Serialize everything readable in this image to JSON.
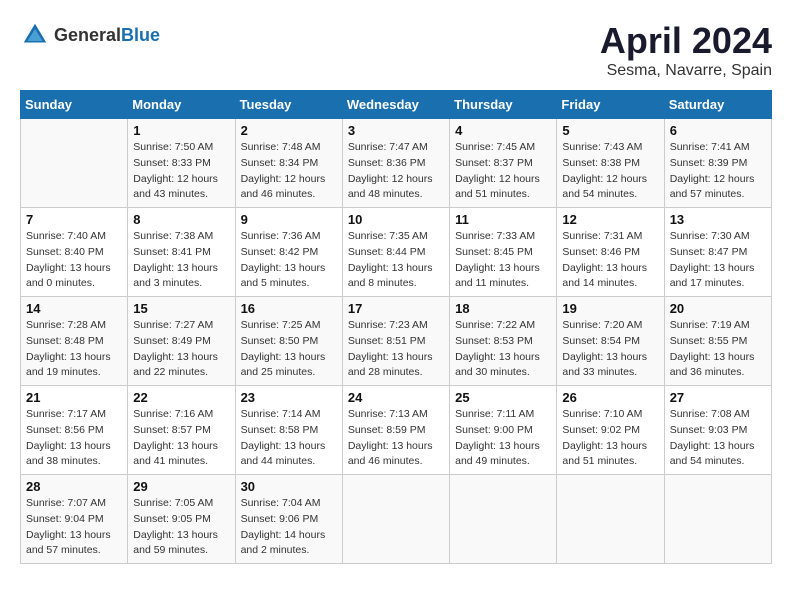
{
  "header": {
    "logo_general": "General",
    "logo_blue": "Blue",
    "month": "April 2024",
    "location": "Sesma, Navarre, Spain"
  },
  "days_of_week": [
    "Sunday",
    "Monday",
    "Tuesday",
    "Wednesday",
    "Thursday",
    "Friday",
    "Saturday"
  ],
  "weeks": [
    [
      {
        "day": "",
        "info": ""
      },
      {
        "day": "1",
        "info": "Sunrise: 7:50 AM\nSunset: 8:33 PM\nDaylight: 12 hours\nand 43 minutes."
      },
      {
        "day": "2",
        "info": "Sunrise: 7:48 AM\nSunset: 8:34 PM\nDaylight: 12 hours\nand 46 minutes."
      },
      {
        "day": "3",
        "info": "Sunrise: 7:47 AM\nSunset: 8:36 PM\nDaylight: 12 hours\nand 48 minutes."
      },
      {
        "day": "4",
        "info": "Sunrise: 7:45 AM\nSunset: 8:37 PM\nDaylight: 12 hours\nand 51 minutes."
      },
      {
        "day": "5",
        "info": "Sunrise: 7:43 AM\nSunset: 8:38 PM\nDaylight: 12 hours\nand 54 minutes."
      },
      {
        "day": "6",
        "info": "Sunrise: 7:41 AM\nSunset: 8:39 PM\nDaylight: 12 hours\nand 57 minutes."
      }
    ],
    [
      {
        "day": "7",
        "info": "Sunrise: 7:40 AM\nSunset: 8:40 PM\nDaylight: 13 hours\nand 0 minutes."
      },
      {
        "day": "8",
        "info": "Sunrise: 7:38 AM\nSunset: 8:41 PM\nDaylight: 13 hours\nand 3 minutes."
      },
      {
        "day": "9",
        "info": "Sunrise: 7:36 AM\nSunset: 8:42 PM\nDaylight: 13 hours\nand 5 minutes."
      },
      {
        "day": "10",
        "info": "Sunrise: 7:35 AM\nSunset: 8:44 PM\nDaylight: 13 hours\nand 8 minutes."
      },
      {
        "day": "11",
        "info": "Sunrise: 7:33 AM\nSunset: 8:45 PM\nDaylight: 13 hours\nand 11 minutes."
      },
      {
        "day": "12",
        "info": "Sunrise: 7:31 AM\nSunset: 8:46 PM\nDaylight: 13 hours\nand 14 minutes."
      },
      {
        "day": "13",
        "info": "Sunrise: 7:30 AM\nSunset: 8:47 PM\nDaylight: 13 hours\nand 17 minutes."
      }
    ],
    [
      {
        "day": "14",
        "info": "Sunrise: 7:28 AM\nSunset: 8:48 PM\nDaylight: 13 hours\nand 19 minutes."
      },
      {
        "day": "15",
        "info": "Sunrise: 7:27 AM\nSunset: 8:49 PM\nDaylight: 13 hours\nand 22 minutes."
      },
      {
        "day": "16",
        "info": "Sunrise: 7:25 AM\nSunset: 8:50 PM\nDaylight: 13 hours\nand 25 minutes."
      },
      {
        "day": "17",
        "info": "Sunrise: 7:23 AM\nSunset: 8:51 PM\nDaylight: 13 hours\nand 28 minutes."
      },
      {
        "day": "18",
        "info": "Sunrise: 7:22 AM\nSunset: 8:53 PM\nDaylight: 13 hours\nand 30 minutes."
      },
      {
        "day": "19",
        "info": "Sunrise: 7:20 AM\nSunset: 8:54 PM\nDaylight: 13 hours\nand 33 minutes."
      },
      {
        "day": "20",
        "info": "Sunrise: 7:19 AM\nSunset: 8:55 PM\nDaylight: 13 hours\nand 36 minutes."
      }
    ],
    [
      {
        "day": "21",
        "info": "Sunrise: 7:17 AM\nSunset: 8:56 PM\nDaylight: 13 hours\nand 38 minutes."
      },
      {
        "day": "22",
        "info": "Sunrise: 7:16 AM\nSunset: 8:57 PM\nDaylight: 13 hours\nand 41 minutes."
      },
      {
        "day": "23",
        "info": "Sunrise: 7:14 AM\nSunset: 8:58 PM\nDaylight: 13 hours\nand 44 minutes."
      },
      {
        "day": "24",
        "info": "Sunrise: 7:13 AM\nSunset: 8:59 PM\nDaylight: 13 hours\nand 46 minutes."
      },
      {
        "day": "25",
        "info": "Sunrise: 7:11 AM\nSunset: 9:00 PM\nDaylight: 13 hours\nand 49 minutes."
      },
      {
        "day": "26",
        "info": "Sunrise: 7:10 AM\nSunset: 9:02 PM\nDaylight: 13 hours\nand 51 minutes."
      },
      {
        "day": "27",
        "info": "Sunrise: 7:08 AM\nSunset: 9:03 PM\nDaylight: 13 hours\nand 54 minutes."
      }
    ],
    [
      {
        "day": "28",
        "info": "Sunrise: 7:07 AM\nSunset: 9:04 PM\nDaylight: 13 hours\nand 57 minutes."
      },
      {
        "day": "29",
        "info": "Sunrise: 7:05 AM\nSunset: 9:05 PM\nDaylight: 13 hours\nand 59 minutes."
      },
      {
        "day": "30",
        "info": "Sunrise: 7:04 AM\nSunset: 9:06 PM\nDaylight: 14 hours\nand 2 minutes."
      },
      {
        "day": "",
        "info": ""
      },
      {
        "day": "",
        "info": ""
      },
      {
        "day": "",
        "info": ""
      },
      {
        "day": "",
        "info": ""
      }
    ]
  ]
}
